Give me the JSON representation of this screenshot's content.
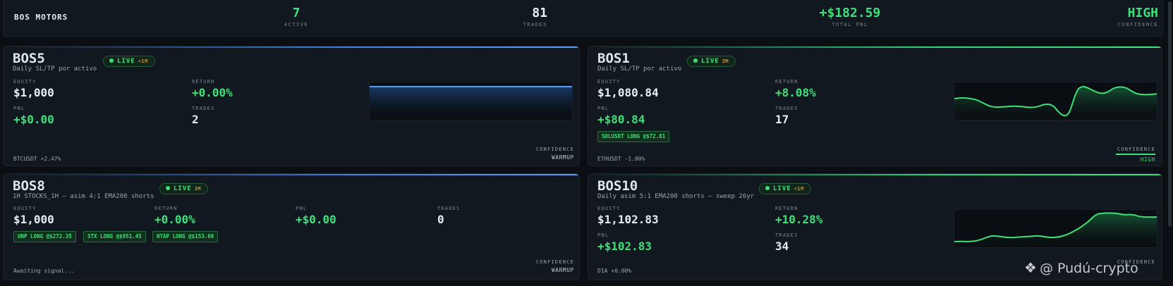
{
  "header": {
    "brand": "BOS MOTORS",
    "active": {
      "value": "7",
      "label": "ACTIVE"
    },
    "trades": {
      "value": "81",
      "label": "TRADES"
    },
    "pnl": {
      "value": "+$182.59",
      "label": "TOTAL PNL"
    },
    "confidence": {
      "value": "HIGH",
      "label": "CONFIDENCE"
    }
  },
  "labels": {
    "equity": "EQUITY",
    "return": "RETURN",
    "pnl": "PNL",
    "trades": "TRADES",
    "confidence": "CONFIDENCE",
    "live": "LIVE"
  },
  "cards": [
    {
      "name": "BOS5",
      "subtitle": "Daily SL/TP por activo",
      "live_age": "<1M",
      "equity": "$1,000",
      "return": "+0.00%",
      "pnl": "+$0.00",
      "trades": "2",
      "positions": [],
      "footer": "BTCUSDT +2.47%",
      "confidence": "WARMUP",
      "accent": "#3f7fd8"
    },
    {
      "name": "BOS1",
      "subtitle": "Daily SL/TP por activo",
      "live_age": "3M",
      "equity": "$1,080.84",
      "return": "+8.08%",
      "pnl": "+$80.84",
      "trades": "17",
      "positions": [
        "SOLUSDT LONG @$72.81"
      ],
      "footer": "ETHUSDT -1.00%",
      "confidence": "HIGH",
      "accent": "#3fe07a"
    },
    {
      "name": "BOS8",
      "subtitle": "1H STOCKS_1H — asim 4:1 EMA200 shorts",
      "live_age": "3M",
      "equity": "$1,000",
      "return": "+0.00%",
      "pnl": "+$0.00",
      "trades": "0",
      "positions": [
        "UNP LONG @$272.35",
        "STX LONG @$951.45",
        "NTAP LONG @$153.66"
      ],
      "footer": "Awaiting signal...",
      "confidence": "WARMUP",
      "accent": "#3f7fd8"
    },
    {
      "name": "BOS10",
      "subtitle": "Daily asim 5:1 EMA200 shorts — sweep 26yr",
      "live_age": "<1M",
      "equity": "$1,102.83",
      "return": "+10.28%",
      "pnl": "+$102.83",
      "trades": "34",
      "positions": [],
      "footer": "DIA +0.00%",
      "confidence": "",
      "accent": "#3fe07a"
    }
  ],
  "watermark": {
    "text": "@ Pudú-crypto",
    "icon": "binance-logo-icon"
  },
  "colors": {
    "green": "#3fe07a",
    "blue": "#3f7fd8",
    "bg": "#0b0f14",
    "card": "#111820"
  }
}
